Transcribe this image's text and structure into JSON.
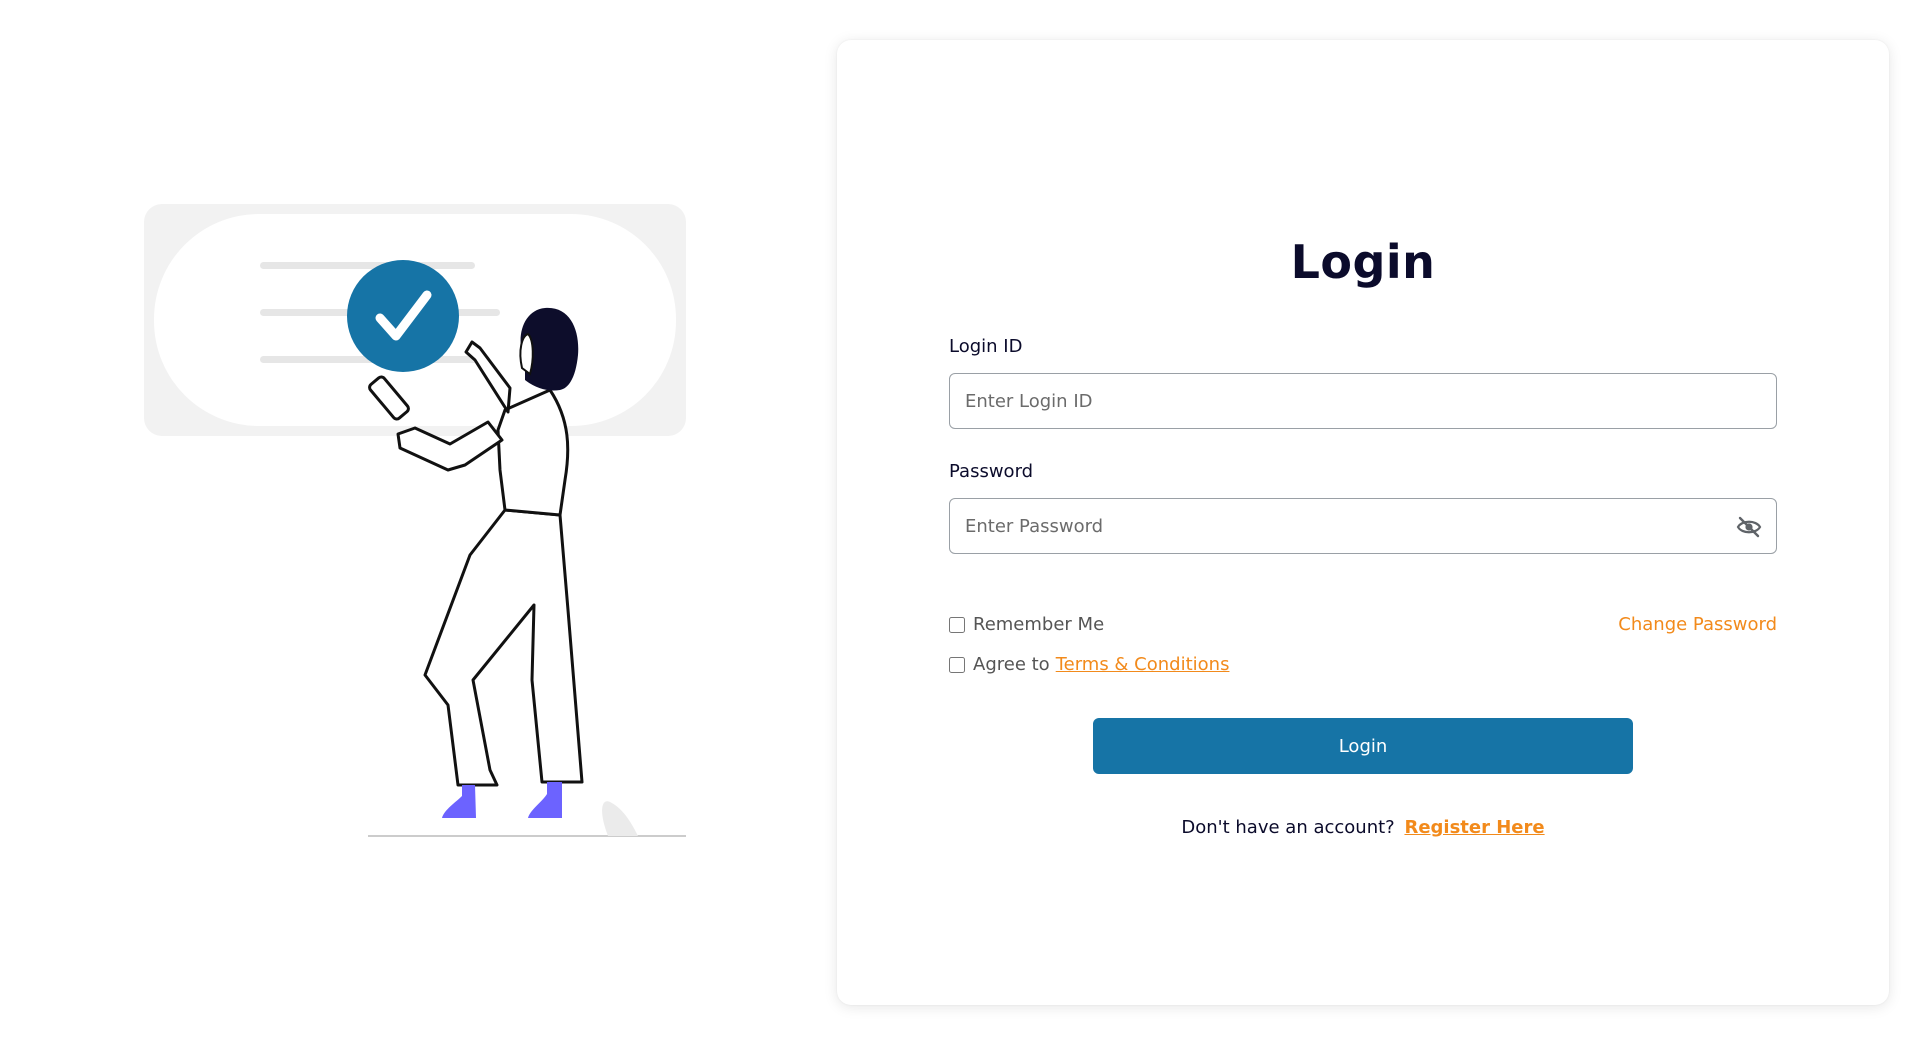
{
  "login_card": {
    "title": "Login",
    "login_id": {
      "label": "Login ID",
      "value": "",
      "placeholder": "Enter Login ID"
    },
    "password": {
      "label": "Password",
      "value": "",
      "placeholder": "Enter Password",
      "toggle_icon": "eye-off-icon"
    },
    "remember_me": {
      "label": "Remember Me",
      "checked": false
    },
    "change_password_label": "Change Password",
    "agree": {
      "prefix": "Agree to",
      "link_label": "Terms & Conditions",
      "checked": false
    },
    "submit_label": "Login",
    "register": {
      "prompt": "Don't have an account?",
      "link_label": "Register Here"
    }
  },
  "colors": {
    "primary": "#1674a6",
    "accent": "#f28a1b",
    "title": "#0b0b2b",
    "illustration_shoes": "#6c63ff",
    "illustration_panel": "#f2f2f2"
  }
}
